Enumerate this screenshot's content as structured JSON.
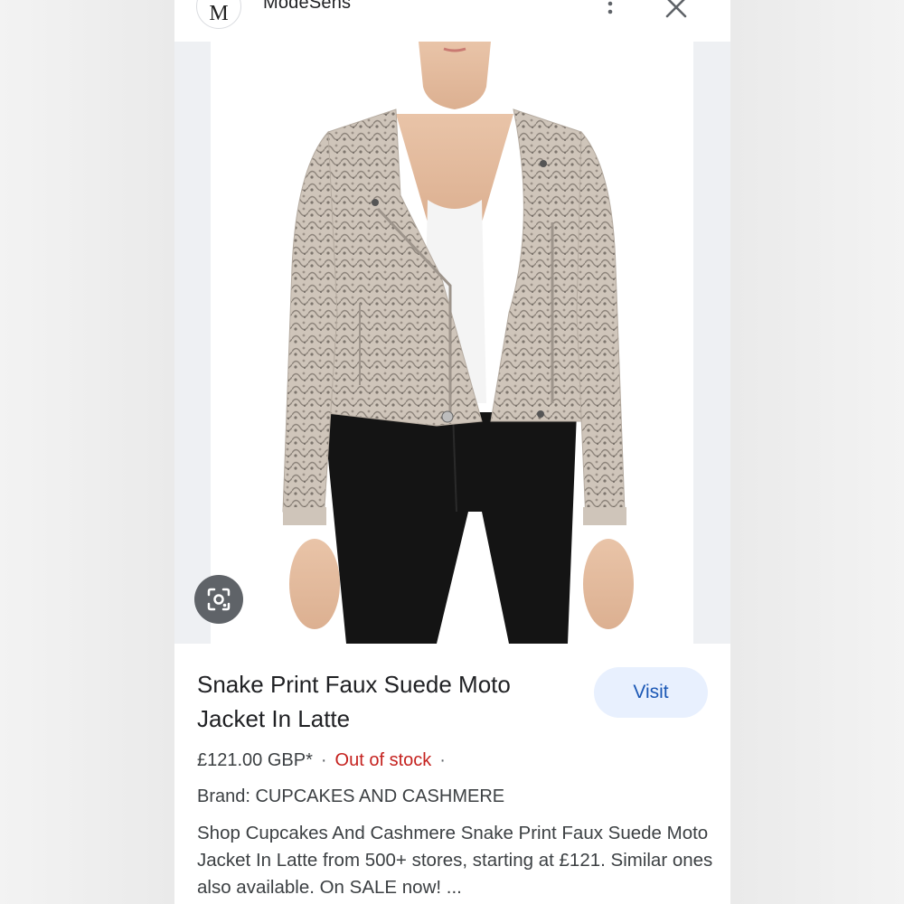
{
  "header": {
    "logo_letter": "M",
    "site_name": "ModeSens",
    "more_icon": "more-vert-icon",
    "close_icon": "close-icon"
  },
  "image": {
    "alt": "Snake print faux suede moto jacket worn with white top and black jeans",
    "lens_icon": "google-lens-icon"
  },
  "product": {
    "title": "Snake Print Faux Suede Moto Jacket In Latte",
    "visit_label": "Visit",
    "price": "£121.00 GBP*",
    "separator": "·",
    "stock_status": "Out of stock",
    "brand": "Brand: CUPCAKES AND CASHMERE",
    "description": "Shop Cupcakes And Cashmere Snake Print Faux Suede Moto Jacket In Latte from 500+ stores, starting at £121. Similar ones also available. On SALE now! ..."
  },
  "colors": {
    "stock_status": "#c5221f",
    "visit_text": "#1a57b5",
    "visit_bg": "#e8f0fe"
  }
}
